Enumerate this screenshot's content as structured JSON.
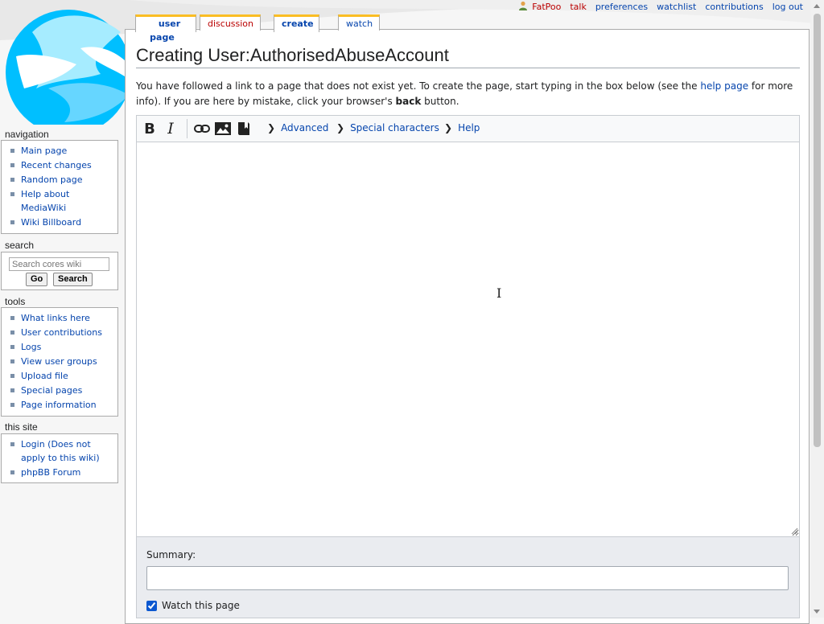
{
  "personal": {
    "username": "FatPoo",
    "talk": "talk",
    "preferences": "preferences",
    "watchlist": "watchlist",
    "contributions": "contributions",
    "logout": "log out"
  },
  "tabs": {
    "user_page": "user page",
    "discussion": "discussion",
    "create": "create",
    "watch": "watch"
  },
  "page": {
    "heading": "Creating User:AuthorisedAbuseAccount",
    "intro_part1": "You have followed a link to a page that does not exist yet. To create the page, start typing in the box below (see the ",
    "intro_link": "help page",
    "intro_part2": " for more info). If you are here by mistake, click your browser's ",
    "intro_bold": "back",
    "intro_part3": " button."
  },
  "toolbar": {
    "bold": "B",
    "italic": "I",
    "advanced": "Advanced",
    "special_characters": "Special characters",
    "help": "Help"
  },
  "editor": {
    "textbox_value": "",
    "summary_label": "Summary:",
    "summary_value": "",
    "watch_label": "Watch this page",
    "watch_checked": true
  },
  "sidebar": {
    "navigation": {
      "heading": "navigation",
      "items": [
        "Main page",
        "Recent changes",
        "Random page",
        "Help about MediaWiki",
        "Wiki Billboard"
      ]
    },
    "search": {
      "heading": "search",
      "placeholder": "Search cores wiki",
      "go": "Go",
      "search": "Search"
    },
    "tools": {
      "heading": "tools",
      "items": [
        "What links here",
        "User contributions",
        "Logs",
        "View user groups",
        "Upload file",
        "Special pages",
        "Page information"
      ]
    },
    "this_site": {
      "heading": "this site",
      "items": [
        "Login (Does not apply to this wiki)",
        "phpBB Forum"
      ]
    }
  },
  "colors": {
    "link": "#0645ad",
    "redlink": "#ba0000",
    "tab_accent": "#fabd23",
    "logo_cyan": "#00bfff"
  }
}
